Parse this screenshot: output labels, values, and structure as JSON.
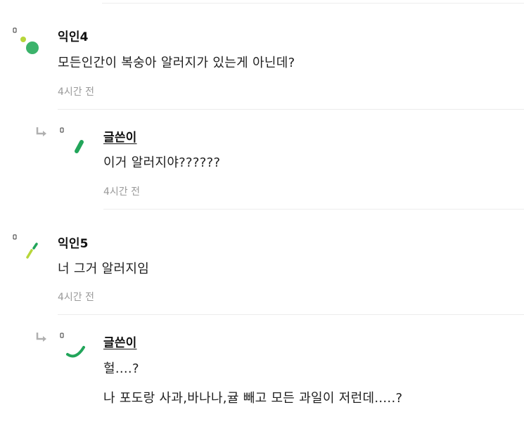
{
  "comments": [
    {
      "author": "익인4",
      "text": "모든인간이 복숭아 알러지가 있는게 아닌데?",
      "time": "4시간 전"
    },
    {
      "author": "글쓴이",
      "text": "이거 알러지야??????",
      "time": "4시간 전",
      "is_reply": true
    },
    {
      "author": "익인5",
      "text": "너 그거 알러지임",
      "time": "4시간 전"
    },
    {
      "author": "글쓴이",
      "text_line1": "헐....?",
      "text_line2": "나 포도랑 사과,바나나,귤 빼고 모든 과일이 저런데.....?",
      "is_reply": true
    }
  ],
  "colors": {
    "green": "#3bb36b",
    "lime": "#b7d63a",
    "teal_green": "#22a55a",
    "divider": "#ececec",
    "meta": "#9a9a9a"
  },
  "icons": {
    "reply": "reply-arrow-icon",
    "avatar": "anonymous-avatar-icon"
  }
}
